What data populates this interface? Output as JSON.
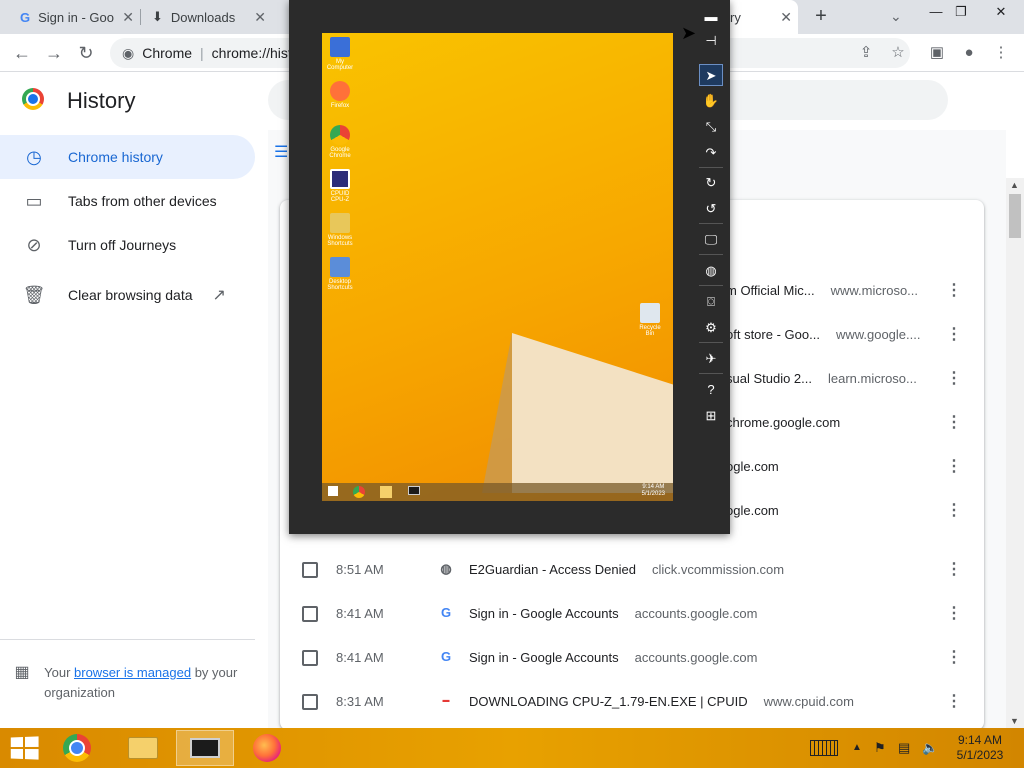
{
  "browser": {
    "tabs": [
      {
        "label": "Sign in - Goo",
        "icon": "google-icon"
      },
      {
        "label": "Downloads",
        "icon": "download-icon"
      },
      {
        "label": "ry",
        "icon": "history-icon"
      }
    ],
    "new_tab": "+",
    "omnibox": {
      "site": "Chrome",
      "url": "chrome://hist"
    }
  },
  "history": {
    "title": "History",
    "sidebar": [
      {
        "label": "Chrome history",
        "icon": "clock-icon"
      },
      {
        "label": "Tabs from other devices",
        "icon": "devices-icon"
      },
      {
        "label": "Turn off Journeys",
        "icon": "journeys-off-icon"
      },
      {
        "label": "Clear browsing data",
        "icon": "trash-icon"
      }
    ],
    "managed": {
      "prefix": "Your ",
      "link": "browser is managed",
      "suffix": " by your organization"
    },
    "partial_rows": [
      {
        "title": "m Official Mic...",
        "domain": "www.microso..."
      },
      {
        "title": "oft store - Goo...",
        "domain": "www.google...."
      },
      {
        "title": "sual Studio 2...",
        "domain": "learn.microso..."
      },
      {
        "title": "chrome.google.com",
        "domain": ""
      },
      {
        "title": "ogle.com",
        "domain": ""
      },
      {
        "title": "ogle.com",
        "domain": ""
      }
    ],
    "rows": [
      {
        "time": "8:51 AM",
        "favicon": "globe-icon",
        "title": "E2Guardian - Access Denied",
        "domain": "click.vcommission.com"
      },
      {
        "time": "8:41 AM",
        "favicon": "google-icon",
        "title": "Sign in - Google Accounts",
        "domain": "accounts.google.com"
      },
      {
        "time": "8:41 AM",
        "favicon": "google-icon",
        "title": "Sign in - Google Accounts",
        "domain": "accounts.google.com"
      },
      {
        "time": "8:31 AM",
        "favicon": "cpuid-icon",
        "title": "DOWNLOADING CPU-Z_1.79-EN.EXE | CPUID",
        "domain": "www.cpuid.com"
      }
    ]
  },
  "vm": {
    "desktop_icons": [
      {
        "label": "My Computer"
      },
      {
        "label": "Firefox"
      },
      {
        "label": "Google Chrome"
      },
      {
        "label": "CPUID CPU-Z"
      },
      {
        "label": "Windows Shortcuts"
      },
      {
        "label": "Desktop Shortcuts"
      }
    ],
    "recycle_bin": "Recycle Bin",
    "clock": {
      "time": "9:14 AM",
      "date": "5/1/2023"
    }
  },
  "taskbar": {
    "clock_time": "9:14 AM",
    "clock_date": "5/1/2023"
  }
}
